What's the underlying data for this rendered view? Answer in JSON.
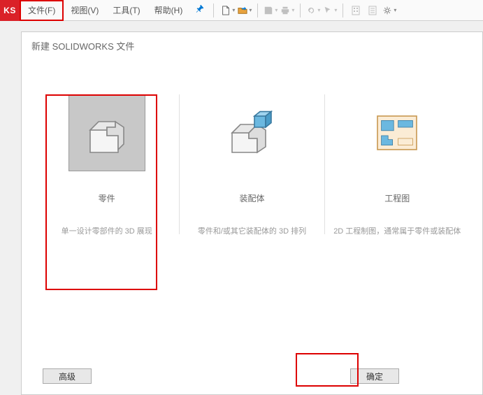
{
  "logo": "KS",
  "menu": {
    "file": "文件(F)",
    "view": "视图(V)",
    "tools": "工具(T)",
    "help": "帮助(H)"
  },
  "dialog": {
    "title": "新建 SOLIDWORKS 文件",
    "options": {
      "part": {
        "title": "零件",
        "desc": "单一设计零部件的 3D 展现"
      },
      "assembly": {
        "title": "装配体",
        "desc": "零件和/或其它装配体的 3D 排列"
      },
      "drawing": {
        "title": "工程图",
        "desc": "2D 工程制图，通常属于零件或装配体"
      }
    },
    "buttons": {
      "advanced": "高级",
      "ok": "确定"
    }
  }
}
